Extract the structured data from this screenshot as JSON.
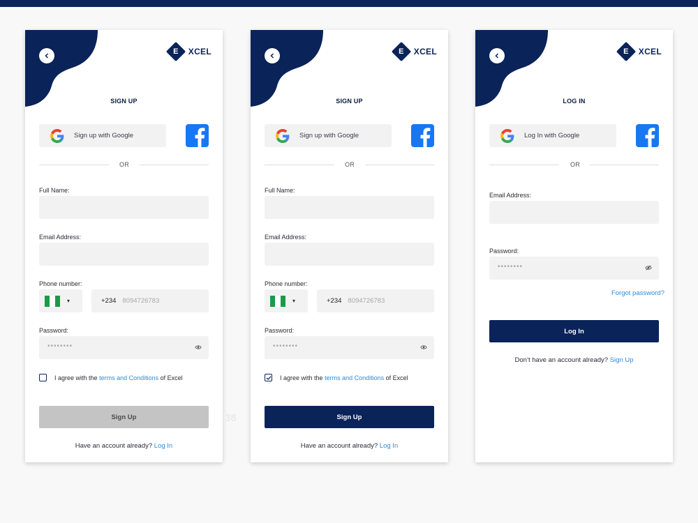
{
  "brand": {
    "logo_letter": "E",
    "logo_text": "XCEL",
    "color_primary": "#0a2358",
    "color_link": "#2f8bd6"
  },
  "watermark": "38",
  "screens": [
    {
      "title": "SIGN UP",
      "google_label": "Sign up with Google",
      "or_text": "OR",
      "full_name_label": "Full Name:",
      "email_label": "Email Address:",
      "phone_label": "Phone number:",
      "country_code": "+234",
      "phone_placeholder": "8094726783",
      "password_label": "Password:",
      "password_mask": "••••••••",
      "agree_prefix": "I agree with the",
      "agree_link": "terms and Conditions",
      "agree_suffix": "of Excel",
      "agree_checked": false,
      "submit_label": "Sign Up",
      "submit_state": "disabled",
      "footer_text": "Have an account already?",
      "footer_link": "Log In"
    },
    {
      "title": "SIGN UP",
      "google_label": "Sign up with Google",
      "or_text": "OR",
      "full_name_label": "Full Name:",
      "email_label": "Email Address:",
      "phone_label": "Phone number:",
      "country_code": "+234",
      "phone_placeholder": "8094726783",
      "password_label": "Password:",
      "password_mask": "••••••••",
      "agree_prefix": "I agree with the",
      "agree_link": "terms and Conditions",
      "agree_suffix": "of Excel",
      "agree_checked": true,
      "submit_label": "Sign Up",
      "submit_state": "active",
      "footer_text": "Have an account already?",
      "footer_link": "Log In"
    },
    {
      "title": "LOG IN",
      "google_label": "Log In with Google",
      "or_text": "OR",
      "email_label": "Email Address:",
      "password_label": "Password:",
      "password_mask": "••••••••",
      "forgot_label": "Forgot password?",
      "submit_label": "Log In",
      "submit_state": "active",
      "footer_text": "Don’t have an account already?",
      "footer_link": "Sign Up"
    }
  ]
}
